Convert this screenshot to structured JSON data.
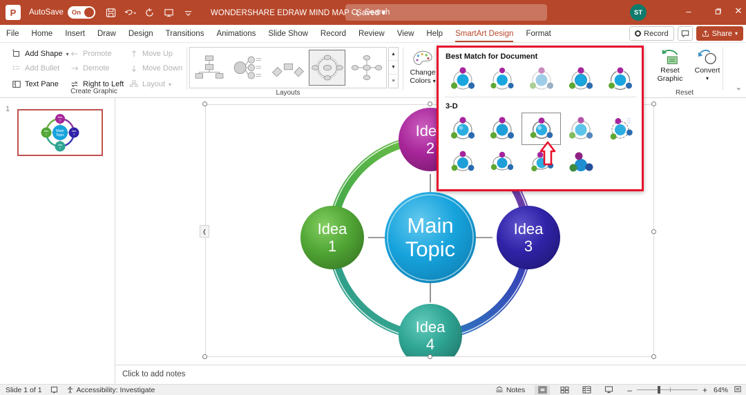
{
  "titlebar": {
    "logo": "P",
    "autosave_label": "AutoSave",
    "autosave_state": "On",
    "document_title": "WONDERSHARE EDRAW MIND MAP",
    "save_state": "Saved",
    "quick_access": [
      {
        "name": "save-icon",
        "label": "Save"
      },
      {
        "name": "undo-icon",
        "label": "Undo"
      },
      {
        "name": "redo-icon",
        "label": "Redo"
      },
      {
        "name": "start-presentation-icon",
        "label": "Start From Beginning"
      },
      {
        "name": "customize-quick-access-icon",
        "label": "Customize Quick Access Toolbar"
      }
    ],
    "search": {
      "placeholder": "Search",
      "icon": "search-icon"
    },
    "account_initials": "ST",
    "window_controls": [
      {
        "name": "minimize-button",
        "glyph": "–"
      },
      {
        "name": "restore-button",
        "glyph": "❐"
      },
      {
        "name": "close-button",
        "glyph": "✕"
      }
    ]
  },
  "tabs": [
    {
      "label": "File",
      "active": false
    },
    {
      "label": "Home",
      "active": false
    },
    {
      "label": "Insert",
      "active": false
    },
    {
      "label": "Draw",
      "active": false
    },
    {
      "label": "Design",
      "active": false
    },
    {
      "label": "Transitions",
      "active": false
    },
    {
      "label": "Animations",
      "active": false
    },
    {
      "label": "Slide Show",
      "active": false
    },
    {
      "label": "Record",
      "active": false
    },
    {
      "label": "Review",
      "active": false
    },
    {
      "label": "View",
      "active": false
    },
    {
      "label": "Help",
      "active": false
    },
    {
      "label": "SmartArt Design",
      "active": true
    },
    {
      "label": "Format",
      "active": false
    }
  ],
  "tab_right": {
    "record_label": "Record",
    "comments_label": "",
    "share_label": "Share"
  },
  "ribbon": {
    "create_graphic": {
      "group_label": "Create Graphic",
      "items": [
        {
          "label": "Add Shape",
          "enabled": true,
          "dropdown": true,
          "icon": "add-shape-icon"
        },
        {
          "label": "Add Bullet",
          "enabled": false,
          "dropdown": false,
          "icon": "add-bullet-icon"
        },
        {
          "label": "Text Pane",
          "enabled": true,
          "dropdown": false,
          "icon": "text-pane-icon"
        },
        {
          "label": "Promote",
          "enabled": false,
          "dropdown": false,
          "icon": "promote-icon"
        },
        {
          "label": "Demote",
          "enabled": false,
          "dropdown": false,
          "icon": "demote-icon"
        },
        {
          "label": "Right to Left",
          "enabled": true,
          "dropdown": false,
          "icon": "right-to-left-icon"
        },
        {
          "label": "Move Up",
          "enabled": false,
          "dropdown": false,
          "icon": "move-up-icon"
        },
        {
          "label": "Move Down",
          "enabled": false,
          "dropdown": false,
          "icon": "move-down-icon"
        },
        {
          "label": "Layout",
          "enabled": false,
          "dropdown": true,
          "icon": "layout-icon"
        }
      ]
    },
    "layouts": {
      "group_label": "Layouts",
      "selected_index": 3,
      "thumbs": [
        {
          "name": "layout-hierarchy"
        },
        {
          "name": "layout-radial-list"
        },
        {
          "name": "layout-process"
        },
        {
          "name": "layout-cycle-matrix"
        },
        {
          "name": "layout-radial-cluster"
        }
      ],
      "scroll": {
        "up": "▲",
        "down": "▼",
        "more": "≡"
      }
    },
    "change_colors": {
      "label_line1": "Change",
      "label_line2": "Colors",
      "icon": "palette-icon"
    },
    "reset": {
      "group_label": "Reset",
      "reset_graphic_line1": "Reset",
      "reset_graphic_line2": "Graphic",
      "convert_label": "Convert",
      "dialog_launcher": "⌄"
    }
  },
  "smartart_styles_dropdown": {
    "section_best_match": "Best Match for Document",
    "section_3d": "3-D",
    "best_match_styles": [
      {
        "name": "style-simple-fill"
      },
      {
        "name": "style-white-outline"
      },
      {
        "name": "style-subtle-effect"
      },
      {
        "name": "style-moderate-effect"
      },
      {
        "name": "style-intense-effect"
      }
    ],
    "threeD_styles_row1": [
      {
        "name": "style-3d-polished",
        "selected": false
      },
      {
        "name": "style-3d-inset",
        "selected": false
      },
      {
        "name": "style-3d-cartoon",
        "selected": true
      },
      {
        "name": "style-3d-powder",
        "selected": false
      },
      {
        "name": "style-3d-brick-scene",
        "selected": false
      }
    ],
    "threeD_styles_row2": [
      {
        "name": "style-3d-flat-scene",
        "selected": false
      },
      {
        "name": "style-3d-sunset-scene",
        "selected": false
      },
      {
        "name": "style-3d-birds-eye-scene",
        "selected": false
      },
      {
        "name": "style-3d-perspective-scene",
        "selected": false
      }
    ],
    "highlight_color": "#E8112D",
    "pointer": "up-arrow-annotation"
  },
  "thumbnails": {
    "slides": [
      {
        "number": "1",
        "selected": true
      }
    ]
  },
  "slide": {
    "nodes": [
      {
        "id": "main",
        "label_line1": "Main",
        "label_line2": "Topic",
        "color": "#17A3DC"
      },
      {
        "id": "idea1",
        "label_line1": "Idea",
        "label_line2": "1",
        "color": "#52A736"
      },
      {
        "id": "idea2",
        "label_line1": "Idea",
        "label_line2": "2",
        "color": "#A8269A"
      },
      {
        "id": "idea3",
        "label_line1": "Idea",
        "label_line2": "3",
        "color": "#3023A8"
      },
      {
        "id": "idea4",
        "label_line1": "Idea",
        "label_line2": "4",
        "color": "#2FA594"
      }
    ],
    "selected": true
  },
  "notes": {
    "placeholder": "Click to add notes"
  },
  "statusbar": {
    "slide_count": "Slide 1 of 1",
    "accessibility": "Accessibility: Investigate",
    "notes_label": "Notes",
    "views": [
      {
        "name": "normal-view-button",
        "active": true
      },
      {
        "name": "slide-sorter-view-button",
        "active": false
      },
      {
        "name": "reading-view-button",
        "active": false
      },
      {
        "name": "slideshow-view-button",
        "active": false
      }
    ],
    "zoom_out": "–",
    "zoom_in": "+",
    "zoom_level": "64%",
    "fit_slide": "fit-to-window-icon"
  }
}
